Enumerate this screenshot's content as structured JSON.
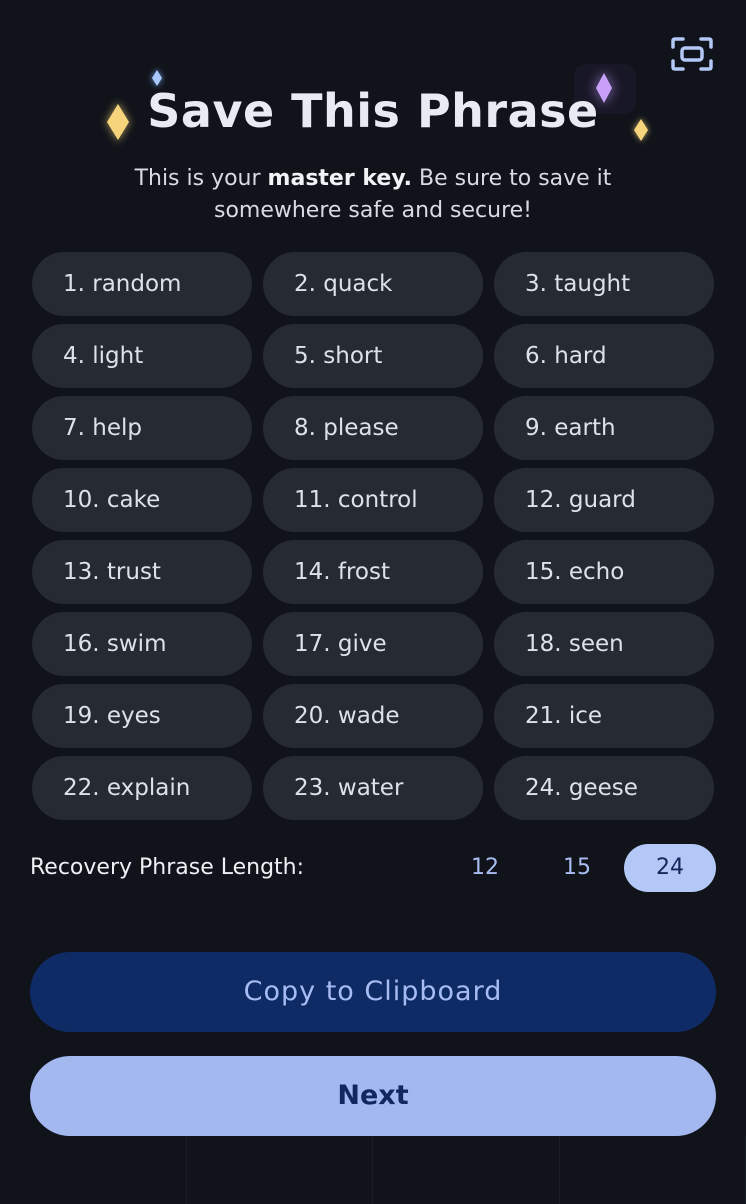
{
  "header": {
    "title": "Save This Phrase",
    "subtitle_prefix": "This is your ",
    "subtitle_bold": "master key.",
    "subtitle_suffix": " Be sure to save it somewhere safe and secure!",
    "scan_icon": "scan-frame-icon"
  },
  "phrase": {
    "words": [
      "1. random",
      "2. quack",
      "3. taught",
      "4. light",
      "5. short",
      "6. hard",
      "7. help",
      "8. please",
      "9. earth",
      "10. cake",
      "11. control",
      "12. guard",
      "13. trust",
      "14. frost",
      "15. echo",
      "16. swim",
      "17. give",
      "18. seen",
      "19. eyes",
      "20. wade",
      "21. ice",
      "22. explain",
      "23. water",
      "24. geese"
    ]
  },
  "length": {
    "label": "Recovery Phrase Length:",
    "options": [
      "12",
      "15",
      "24"
    ],
    "selected": "24"
  },
  "actions": {
    "copy_label": "Copy to Clipboard",
    "next_label": "Next"
  },
  "colors": {
    "background": "#10131a",
    "chip": "#262a33",
    "accent": "#a3b8ef",
    "copy_button": "#0f2b66"
  }
}
